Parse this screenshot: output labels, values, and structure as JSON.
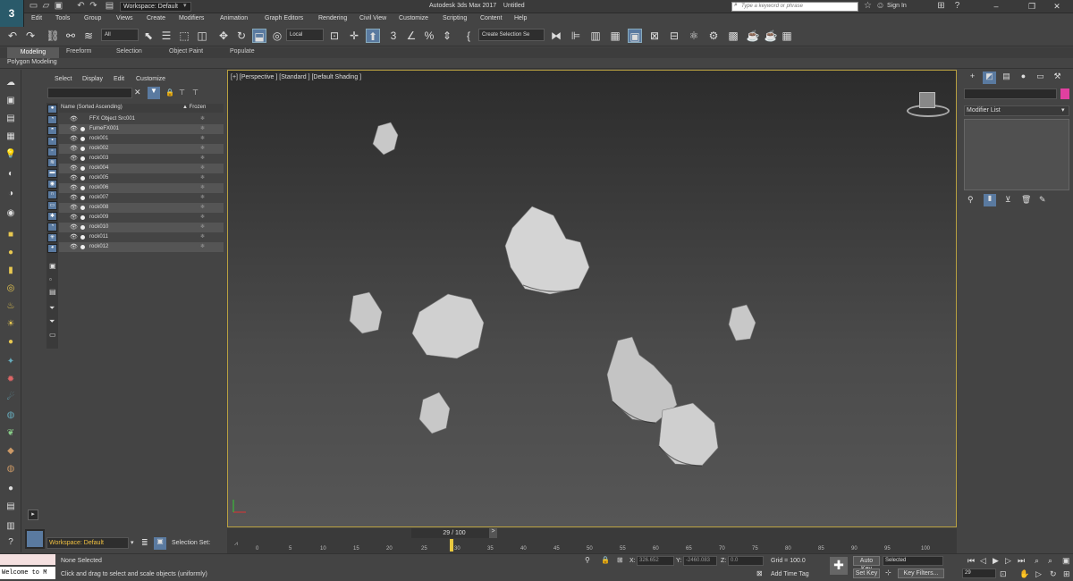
{
  "app": {
    "title": "Autodesk 3ds Max 2017",
    "file": "Untitled",
    "logo": "3",
    "workspace": "Workspace: Default"
  },
  "search": {
    "placeholder": "Type a keyword or phrase"
  },
  "user": {
    "signin": "Sign In"
  },
  "menus": [
    "Edit",
    "Tools",
    "Group",
    "Views",
    "Create",
    "Modifiers",
    "Animation",
    "Graph Editors",
    "Rendering",
    "Civil View",
    "Customize",
    "Scripting",
    "Content",
    "Help"
  ],
  "toolbar": {
    "filter": "All",
    "refcoord": "Local",
    "selset": "Create Selection Se"
  },
  "ribbon": {
    "tabs": [
      "Modeling",
      "Freeform",
      "Selection",
      "Object Paint",
      "Populate"
    ],
    "subtitle": "Polygon Modeling"
  },
  "scene": {
    "menus": [
      "Select",
      "Display",
      "Edit",
      "Customize"
    ],
    "col_name": "Name (Sorted Ascending)",
    "col_frozen": "▲ Frozen",
    "rows": [
      "FFX Object Src001",
      "FumeFX001",
      "rock001",
      "rock002",
      "rock003",
      "rock004",
      "rock005",
      "rock006",
      "rock007",
      "rock008",
      "rock009",
      "rock010",
      "rock011",
      "rock012"
    ]
  },
  "viewport": {
    "label": "[+] [Perspective ] [Standard ] [Default Shading ]"
  },
  "cmd": {
    "modlist": "Modifier List"
  },
  "bottom": {
    "workspace": "Workspace: Default",
    "selset": "Selection Set:",
    "frame": "29 / 100",
    "ticks": [
      "0",
      "5",
      "10",
      "15",
      "20",
      "25",
      "30",
      "35",
      "40",
      "45",
      "50",
      "55",
      "60",
      "65",
      "70",
      "75",
      "80",
      "85",
      "90",
      "95",
      "100"
    ]
  },
  "status": {
    "maxscript": "Welcome to M",
    "selected": "None Selected",
    "hint": "Click and drag to select and scale objects (uniformly)",
    "x": "326.652",
    "y": "-2460.083",
    "z": "0.0",
    "grid": "Grid = 100.0",
    "addtime": "Add Time Tag",
    "autokey": "Auto Key",
    "setkey": "Set Key",
    "selmode": "Selected",
    "keyfilters": "Key Filters...",
    "frame": "29"
  }
}
